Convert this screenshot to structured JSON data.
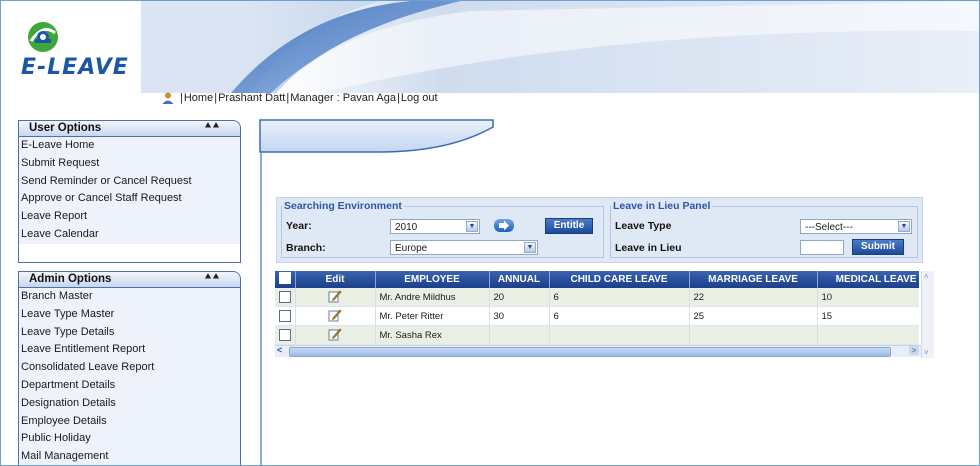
{
  "app": {
    "name": "E-LEAVE"
  },
  "colors": {
    "primary": "#1b3f8a",
    "accent": "#2c56a8",
    "panel_bg": "#eef3fb",
    "row_alt": "#e9f0e3"
  },
  "topnav": {
    "icon": "user-icon",
    "items": [
      {
        "label": "Home"
      },
      {
        "label": "Prashant Datt"
      },
      {
        "label": "Manager : Pavan Aga"
      },
      {
        "label": "Log out"
      }
    ]
  },
  "user_options": {
    "title": "User Options",
    "collapse_icon": "double-chevron-up-icon",
    "items": [
      "E-Leave Home",
      "Submit Request",
      "Send Reminder or Cancel Request",
      "Approve or Cancel Staff Request",
      "Leave Report",
      "Leave Calendar"
    ]
  },
  "admin_options": {
    "title": "Admin Options",
    "collapse_icon": "double-chevron-up-icon",
    "items": [
      "Branch Master",
      "Leave Type Master",
      "Leave Type Details",
      "Leave Entitlement Report",
      "Consolidated Leave Report",
      "Department Details",
      "Designation Details",
      "Employee Details",
      "Public Holiday",
      "Mail Management"
    ]
  },
  "search": {
    "legend": "Searching Environment",
    "year_label": "Year:",
    "year_value": "2010",
    "branch_label": "Branch:",
    "branch_value": "Europe",
    "go_icon": "arrow-right-icon",
    "entitle_label": "Entitle"
  },
  "lieu": {
    "legend": "Leave in Lieu Panel",
    "leave_type_label": "Leave Type",
    "leave_type_value": "---Select---",
    "leave_in_lieu_label": "Leave in Lieu",
    "leave_in_lieu_value": "",
    "submit_label": "Submit"
  },
  "grid": {
    "columns": [
      "",
      "Edit",
      "EMPLOYEE",
      "ANNUAL",
      "CHILD CARE LEAVE",
      "MARRIAGE LEAVE",
      "MEDICAL LEAVE"
    ],
    "rows": [
      {
        "employee": "Mr. Andre Mildhus",
        "annual": "20",
        "child_care": "6",
        "marriage": "22",
        "medical": "10"
      },
      {
        "employee": "Mr. Peter Ritter",
        "annual": "30",
        "child_care": "6",
        "marriage": "25",
        "medical": "15"
      },
      {
        "employee": "Mr. Sasha Rex",
        "annual": "",
        "child_care": "",
        "marriage": "",
        "medical": ""
      }
    ],
    "edit_icon": "edit-pencil-icon"
  }
}
